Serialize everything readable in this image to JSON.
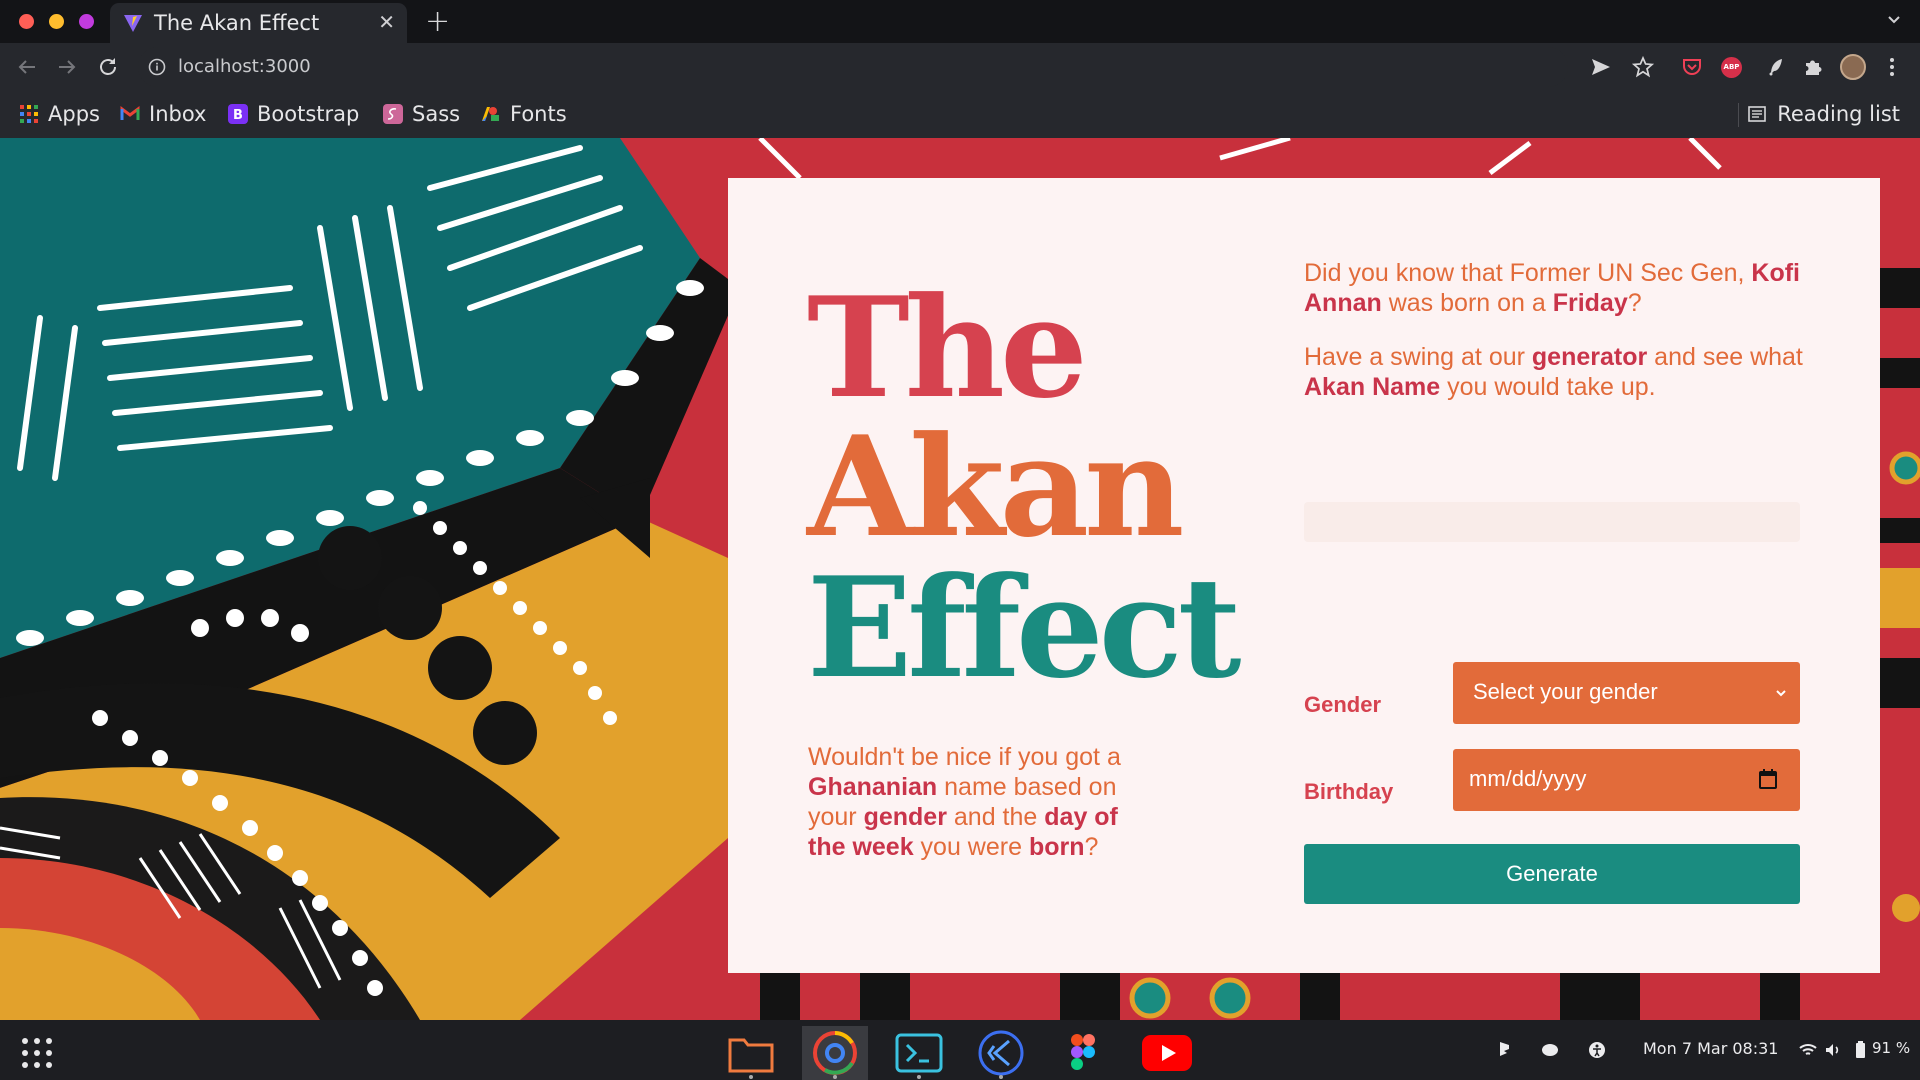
{
  "browser": {
    "tab_title": "The Akan Effect",
    "url": "localhost:3000",
    "bookmarks": [
      {
        "label": "Apps",
        "icon": "apps-grid-icon"
      },
      {
        "label": "Inbox",
        "icon": "gmail-icon"
      },
      {
        "label": "Bootstrap",
        "icon": "bootstrap-icon"
      },
      {
        "label": "Sass",
        "icon": "sass-icon"
      },
      {
        "label": "Fonts",
        "icon": "google-fonts-icon"
      }
    ],
    "reading_list": "Reading list"
  },
  "hero": {
    "line1": "The",
    "line2": "Akan",
    "line3": "Effect",
    "colors": {
      "line1": "#d6424f",
      "line2": "#e26b3a",
      "line3": "#1a8c80"
    }
  },
  "lead": {
    "parts": [
      "Wouldn't be nice if you got a ",
      "Ghananian",
      " name based on your ",
      "gender",
      " and the ",
      "day of the week",
      " you were ",
      "born",
      "?"
    ]
  },
  "fact": {
    "p1": [
      "Did you know that Former UN Sec Gen, ",
      "Kofi Annan",
      " was born on a ",
      "Friday",
      "?"
    ],
    "p2": [
      "Have a swing at our ",
      "generator",
      " and see what ",
      "Akan Name",
      " you would take up."
    ]
  },
  "form": {
    "gender_label": "Gender",
    "gender_placeholder": "Select your gender",
    "birthday_label": "Birthday",
    "birthday_placeholder": "mm/dd/yyyy",
    "submit_label": "Generate",
    "accent": "#e26b3a",
    "primary": "#1a8c80"
  },
  "taskbar": {
    "apps": [
      "files-icon",
      "chrome-icon",
      "terminal-icon",
      "vscode-icon",
      "figma-icon",
      "youtube-icon"
    ],
    "clock": "Mon 7 Mar  08:31",
    "battery": "91 %"
  }
}
